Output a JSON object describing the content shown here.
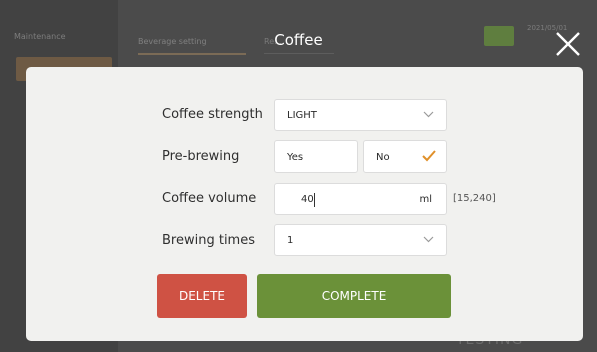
{
  "background": {
    "sidebar_label": "Maintenance",
    "tab_active": "Beverage setting",
    "tab_second": "Re...",
    "date": "2021/05/01",
    "footer_text": "TESTING"
  },
  "dialog": {
    "title": "Coffee",
    "rows": {
      "strength": {
        "label": "Coffee strength",
        "value": "LIGHT"
      },
      "prebrew": {
        "label": "Pre-brewing",
        "option_yes": "Yes",
        "option_no": "No",
        "selected": "No"
      },
      "volume": {
        "label": "Coffee volume",
        "value": "40",
        "unit": "ml",
        "range": "[15,240]"
      },
      "times": {
        "label": "Brewing times",
        "value": "1"
      }
    },
    "buttons": {
      "delete": "DELETE",
      "complete": "COMPLETE"
    }
  },
  "colors": {
    "overlay": "#4b4b4b",
    "panel": "#f1f1ef",
    "delete": "#cf5244",
    "complete": "#6b9139",
    "check": "#e0902a"
  },
  "icons": {
    "close": "close-icon",
    "dropdown": "chevron-down-icon",
    "selected": "checkmark-icon"
  }
}
